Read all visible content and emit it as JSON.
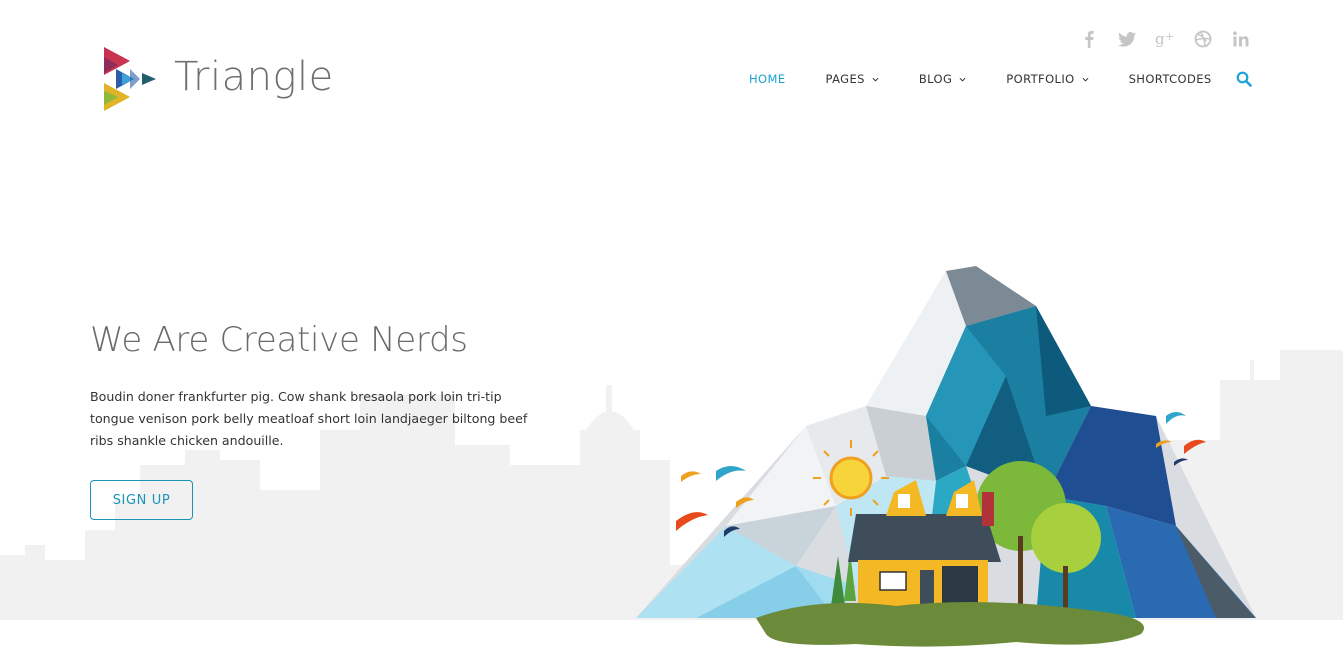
{
  "brand": {
    "name": "Triangle"
  },
  "social": [
    {
      "name": "facebook",
      "glyph": "f"
    },
    {
      "name": "twitter",
      "glyph": "twitter"
    },
    {
      "name": "google-plus",
      "glyph": "g+"
    },
    {
      "name": "dribbble",
      "glyph": "dribbble"
    },
    {
      "name": "linkedin",
      "glyph": "in"
    }
  ],
  "nav": [
    {
      "label": "HOME",
      "active": true,
      "dropdown": false
    },
    {
      "label": "PAGES",
      "active": false,
      "dropdown": true
    },
    {
      "label": "BLOG",
      "active": false,
      "dropdown": true
    },
    {
      "label": "PORTFOLIO",
      "active": false,
      "dropdown": true
    },
    {
      "label": "SHORTCODES",
      "active": false,
      "dropdown": false
    }
  ],
  "hero": {
    "title": "We Are Creative Nerds",
    "text": "Boudin doner frankfurter pig. Cow shank bresaola pork loin tri-tip tongue venison pork belly meatloaf short loin landjaeger biltong beef ribs shankle chicken andouille.",
    "button": "SIGN UP"
  },
  "colors": {
    "accent": "#1ba3d7",
    "button": "#1b93b8",
    "skyline": "#f1f1f1",
    "social_icon": "#c5c5c5"
  }
}
